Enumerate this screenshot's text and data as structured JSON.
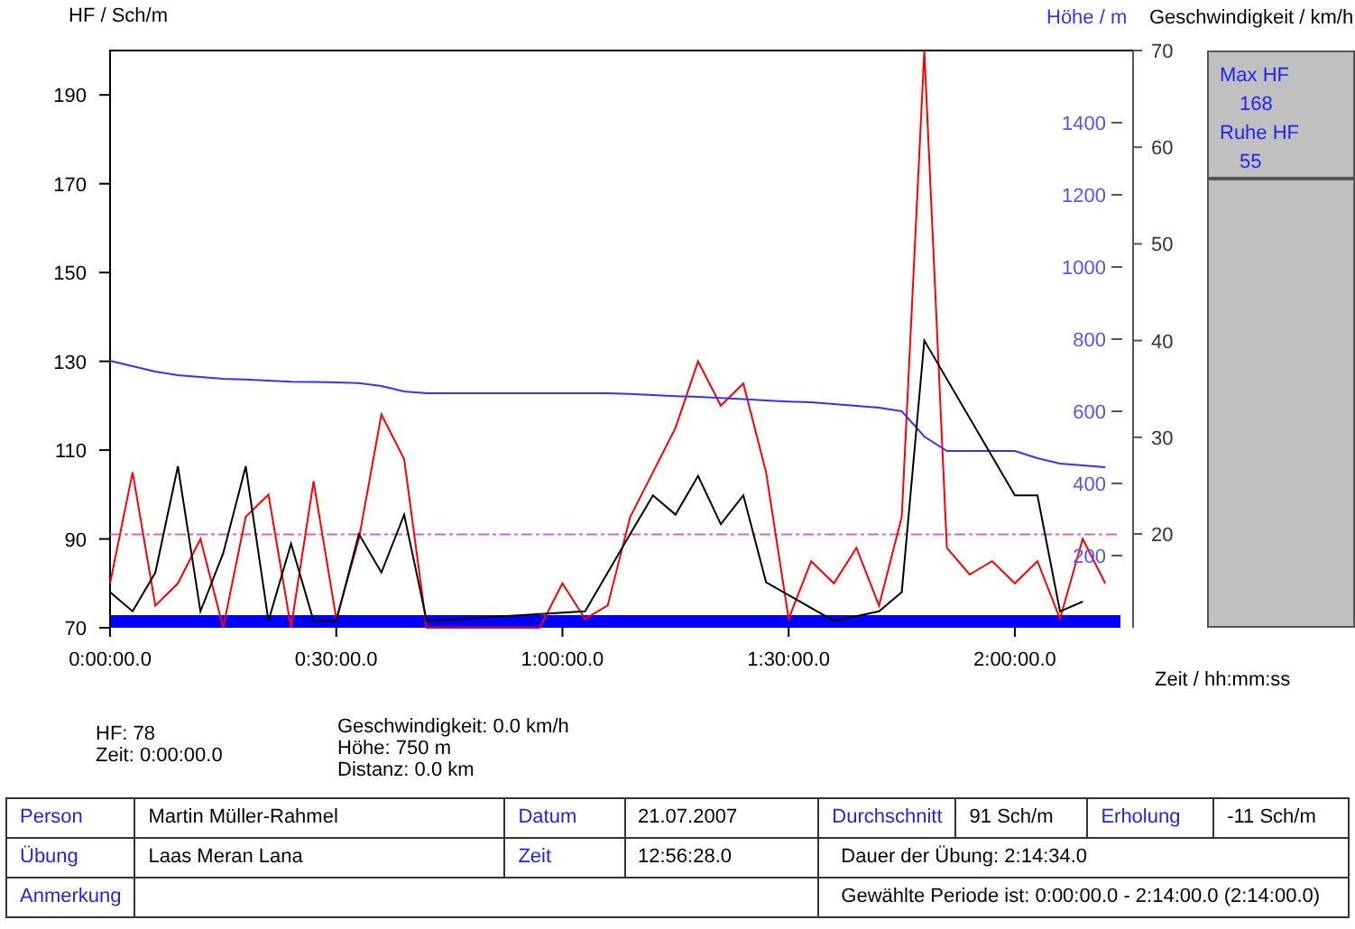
{
  "hf_chart": {
    "chart_data": {
      "type": "line",
      "ylabel": "HF / Sch/m",
      "xlabel": "Zeit / hh:mm:ss",
      "ylim": [
        70,
        200
      ],
      "yticks": [
        70,
        90,
        110,
        130,
        150,
        170,
        190
      ],
      "categories": [
        "0:00:00.0",
        null,
        null,
        null,
        null,
        null,
        null,
        null,
        null,
        null,
        "0:30:00.0",
        null,
        null,
        null,
        null,
        null,
        null,
        null,
        null,
        null,
        "1:00:00.0",
        null,
        null,
        null,
        null,
        null,
        null,
        null,
        null,
        null,
        "1:30:00.0",
        null,
        null,
        null,
        null,
        null,
        null,
        null,
        null,
        null,
        "2:00:00.0",
        null,
        null,
        null,
        null
      ],
      "series": [
        {
          "color": "#ff0000",
          "values": [
            80,
            105,
            75,
            80,
            90,
            70,
            95,
            100,
            70,
            103,
            72,
            90,
            118,
            108,
            70,
            null,
            null,
            null,
            null,
            70,
            80,
            72,
            75,
            95,
            105,
            115,
            130,
            120,
            125,
            105,
            72,
            85,
            80,
            88,
            75,
            95,
            200,
            88,
            82,
            85,
            80,
            85,
            72,
            90,
            80
          ]
        }
      ],
      "ref_lines": [
        {
          "axis": "y",
          "value": 91,
          "color": "#cc66cc"
        }
      ]
    }
  },
  "selection_bar": {
    "color": "#0000ff"
  },
  "altitude_chart": {
    "chart_data": {
      "type": "line",
      "ylabel": "Höhe / m",
      "ylim": [
        0,
        1600
      ],
      "yticks": [
        200,
        400,
        600,
        800,
        1000,
        1200,
        1400
      ],
      "categories": [
        null,
        null,
        null,
        null,
        null,
        null,
        null,
        null,
        null,
        null,
        null,
        null,
        null,
        null,
        null,
        null,
        null,
        null,
        null,
        null,
        null,
        null,
        null,
        null,
        null,
        null,
        null,
        null,
        null,
        null,
        null,
        null,
        null,
        null,
        null,
        null,
        null,
        null,
        null,
        null,
        null,
        null,
        null,
        null,
        null
      ],
      "series": [
        {
          "color": "#3333ff",
          "values": [
            740,
            725,
            710,
            700,
            695,
            690,
            688,
            685,
            682,
            681,
            680,
            678,
            670,
            655,
            650,
            650,
            650,
            650,
            650,
            650,
            650,
            650,
            650,
            648,
            645,
            642,
            640,
            637,
            634,
            630,
            627,
            625,
            620,
            615,
            610,
            600,
            530,
            490,
            490,
            490,
            490,
            470,
            455,
            450,
            445
          ]
        }
      ]
    }
  },
  "speed_chart": {
    "chart_data": {
      "type": "line",
      "ylabel": "Geschwindigkeit / km/h",
      "ylim": [
        10.3,
        70
      ],
      "yticks": [
        20,
        30,
        40,
        50,
        60,
        70
      ],
      "categories": [
        null,
        null,
        null,
        null,
        null,
        null,
        null,
        null,
        null,
        null,
        null,
        null,
        null,
        null,
        null,
        null,
        null,
        null,
        null,
        null,
        null,
        null,
        null,
        null,
        null,
        null,
        null,
        null,
        null,
        null,
        null,
        null,
        null,
        null,
        null,
        null,
        null,
        null,
        null,
        null,
        null,
        null,
        null,
        null,
        null
      ],
      "series": [
        {
          "color": "#000000",
          "values": [
            14,
            12,
            16,
            27,
            12,
            18,
            27,
            11,
            19,
            11,
            11,
            20,
            16,
            22,
            11,
            null,
            null,
            null,
            null,
            null,
            null,
            12,
            null,
            20,
            24,
            22,
            26,
            21,
            24,
            15,
            null,
            null,
            11,
            null,
            12,
            14,
            40,
            null,
            null,
            null,
            24,
            24,
            12,
            13,
            null
          ]
        }
      ]
    }
  },
  "side_panel": [
    {
      "kind": "label",
      "text": "Max HF"
    },
    {
      "kind": "value",
      "text": "168"
    },
    {
      "kind": "label",
      "text": "Ruhe HF"
    },
    {
      "kind": "value",
      "text": "55"
    }
  ],
  "cursor_info": {
    "left": [
      "HF: 78",
      "Zeit: 0:00:00.0"
    ],
    "right": [
      "Geschwindigkeit: 0.0 km/h",
      "Höhe: 750 m",
      "Distanz: 0.0 km"
    ]
  },
  "table": {
    "rows": [
      [
        {
          "kind": "label",
          "text": "Person"
        },
        {
          "kind": "value",
          "text": "Martin Müller-Rahmel"
        },
        {
          "kind": "label",
          "text": "Datum"
        },
        {
          "kind": "value",
          "text": "21.07.2007"
        },
        {
          "kind": "label",
          "text": "Durchschnitt"
        },
        {
          "kind": "value",
          "text": "91 Sch/m"
        },
        {
          "kind": "label",
          "text": "Erholung"
        },
        {
          "kind": "value",
          "text": "-11 Sch/m"
        }
      ],
      [
        {
          "kind": "label",
          "text": "Übung"
        },
        {
          "kind": "value",
          "text": "Laas Meran Lana"
        },
        {
          "kind": "label",
          "text": "Zeit"
        },
        {
          "kind": "value",
          "text": "12:56:28.0"
        },
        {
          "kind": "value",
          "text": "Dauer der Übung: 2:14:34.0",
          "colspan": 4
        }
      ],
      [
        {
          "kind": "label",
          "text": "Anmerkung"
        },
        {
          "kind": "empty",
          "colspan": 3
        },
        {
          "kind": "value",
          "text": "Gewählte Periode ist: 0:00:00.0 - 2:14:00.0 (2:14:00.0)",
          "colspan": 4
        }
      ]
    ]
  }
}
